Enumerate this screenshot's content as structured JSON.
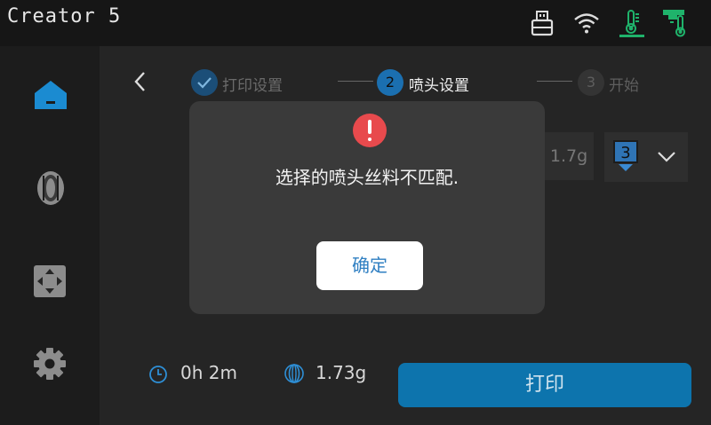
{
  "header": {
    "title": "Creator 5",
    "status_icons": [
      "usb-drive-icon",
      "wifi-icon",
      "bed-temperature-icon",
      "nozzle-temperature-icon"
    ]
  },
  "sidebar": {
    "items": [
      {
        "icon": "home-icon",
        "active": true
      },
      {
        "icon": "filament-spool-icon",
        "active": false
      },
      {
        "icon": "move-control-icon",
        "active": false
      },
      {
        "icon": "settings-gear-icon",
        "active": false
      }
    ]
  },
  "steps": [
    {
      "number": "1",
      "label": "打印设置",
      "state": "done"
    },
    {
      "number": "2",
      "label": "喷头设置",
      "state": "active"
    },
    {
      "number": "3",
      "label": "开始",
      "state": "pending"
    }
  ],
  "nozzle": {
    "weight": "1.7g",
    "selected": "3"
  },
  "summary": {
    "time": "0h 2m",
    "filament": "1.73g"
  },
  "print_button": "打印",
  "dialog": {
    "message": "选择的喷头丝料不匹配.",
    "confirm": "确定"
  },
  "colors": {
    "accent": "#0d74ad",
    "active_blue": "#1b6fb0",
    "warning": "#e84a4d",
    "green": "#1fb36b"
  }
}
